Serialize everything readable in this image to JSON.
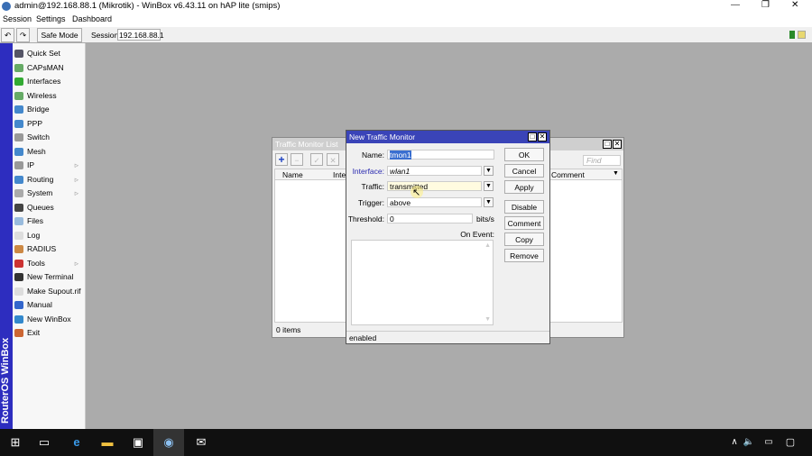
{
  "window": {
    "title": "admin@192.168.88.1 (Mikrotik) - WinBox v6.43.11 on hAP lite (smips)",
    "min": "—",
    "max": "❐",
    "close": "✕"
  },
  "menu": [
    "Session",
    "Settings",
    "Dashboard"
  ],
  "toolbar": {
    "undo": "↶",
    "redo": "↷",
    "safe_mode": "Safe Mode",
    "session_label": "Session:",
    "session_value": "192.168.88.1"
  },
  "brand": "RouterOS WinBox",
  "sidebar": [
    {
      "label": "Quick Set",
      "color": "#556"
    },
    {
      "label": "CAPsMAN",
      "color": "#6a6"
    },
    {
      "label": "Interfaces",
      "color": "#3a3"
    },
    {
      "label": "Wireless",
      "color": "#6a6"
    },
    {
      "label": "Bridge",
      "color": "#48c"
    },
    {
      "label": "PPP",
      "color": "#48c"
    },
    {
      "label": "Switch",
      "color": "#999"
    },
    {
      "label": "Mesh",
      "color": "#48c"
    },
    {
      "label": "IP",
      "color": "#999",
      "sub": "▹"
    },
    {
      "label": "Routing",
      "color": "#48c",
      "sub": "▹"
    },
    {
      "label": "System",
      "color": "#aaa",
      "sub": "▹"
    },
    {
      "label": "Queues",
      "color": "#444"
    },
    {
      "label": "Files",
      "color": "#9bd"
    },
    {
      "label": "Log",
      "color": "#ddd"
    },
    {
      "label": "RADIUS",
      "color": "#c84"
    },
    {
      "label": "Tools",
      "color": "#c33",
      "sub": "▹"
    },
    {
      "label": "New Terminal",
      "color": "#333"
    },
    {
      "label": "Make Supout.rif",
      "color": "#ddd"
    },
    {
      "label": "Manual",
      "color": "#36c"
    },
    {
      "label": "New WinBox",
      "color": "#38c"
    },
    {
      "label": "Exit",
      "color": "#c63"
    }
  ],
  "list": {
    "title": "Traffic Monitor List",
    "find_placeholder": "Find",
    "col_name": "Name",
    "col_inter": "Inter",
    "col_comment": "Comment",
    "count": "0 items"
  },
  "dialog": {
    "title": "New Traffic Monitor",
    "name_label": "Name:",
    "name": "tmon1",
    "interface_label": "Interface:",
    "interface": "wlan1",
    "traffic_label": "Traffic:",
    "traffic": "transmitted",
    "trigger_label": "Trigger:",
    "trigger": "above",
    "threshold_label": "Threshold:",
    "threshold": "0",
    "unit": "bits/s",
    "on_event_label": "On Event:",
    "status": "enabled",
    "buttons": [
      "OK",
      "Cancel",
      "Apply",
      "Disable",
      "Comment",
      "Copy",
      "Remove"
    ]
  },
  "status_colors": {
    "green": "#2a8a2a",
    "lock": "#e8d870"
  }
}
